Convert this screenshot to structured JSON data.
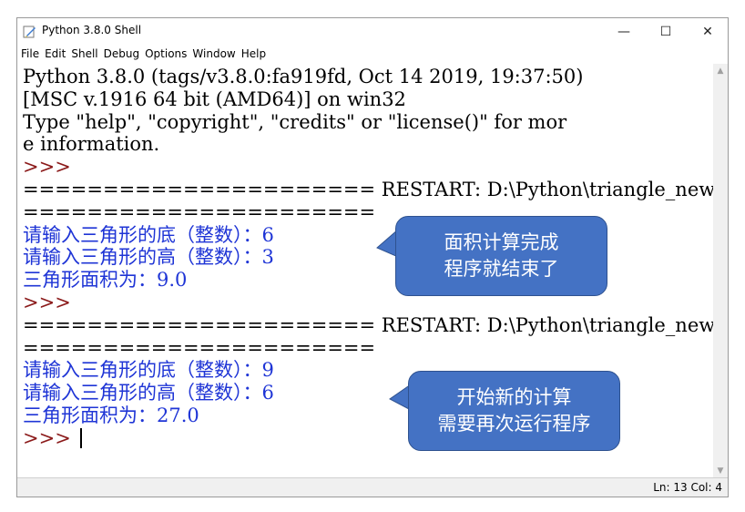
{
  "window": {
    "title": "Python 3.8.0 Shell",
    "controls": {
      "minimize": "—",
      "maximize": "☐",
      "close": "✕"
    }
  },
  "menu": [
    "File",
    "Edit",
    "Shell",
    "Debug",
    "Options",
    "Window",
    "Help"
  ],
  "shell": {
    "lines": [
      {
        "text": "Python 3.8.0 (tags/v3.8.0:fa919fd, Oct 14 2019, 19:37:50)",
        "kind": "normal"
      },
      {
        "text": "[MSC v.1916 64 bit (AMD64)] on win32",
        "kind": "normal"
      },
      {
        "text": "Type \"help\", \"copyright\", \"credits\" or \"license()\" for mor",
        "kind": "normal"
      },
      {
        "text": "e information.",
        "kind": "normal"
      },
      {
        "text": ">>> ",
        "kind": "prompt"
      },
      {
        "text": "====================== RESTART: D:\\Python\\triangle_new.py",
        "kind": "sep"
      },
      {
        "text": "======================",
        "kind": "sep"
      },
      {
        "text": "请输入三角形的底（整数）：6",
        "kind": "blue"
      },
      {
        "text": "请输入三角形的高（整数）：3",
        "kind": "blue"
      },
      {
        "text": "三角形面积为：9.0",
        "kind": "blue"
      },
      {
        "text": ">>> ",
        "kind": "prompt"
      },
      {
        "text": "====================== RESTART: D:\\Python\\triangle_new.py",
        "kind": "sep"
      },
      {
        "text": "======================",
        "kind": "sep"
      },
      {
        "text": "请输入三角形的底（整数）：9",
        "kind": "blue"
      },
      {
        "text": "请输入三角形的高（整数）：6",
        "kind": "blue"
      },
      {
        "text": "三角形面积为：27.0",
        "kind": "blue"
      },
      {
        "text": ">>> ",
        "kind": "prompt",
        "cursor": true
      }
    ]
  },
  "callouts": [
    {
      "line1": "面积计算完成",
      "line2": "程序就结束了"
    },
    {
      "line1": "开始新的计算",
      "line2": "需要再次运行程序"
    }
  ],
  "status": {
    "text": "Ln: 13  Col: 4"
  },
  "colors": {
    "accent": "#4472c4",
    "output_blue": "#1f35d6",
    "prompt": "#8b1a1a"
  }
}
